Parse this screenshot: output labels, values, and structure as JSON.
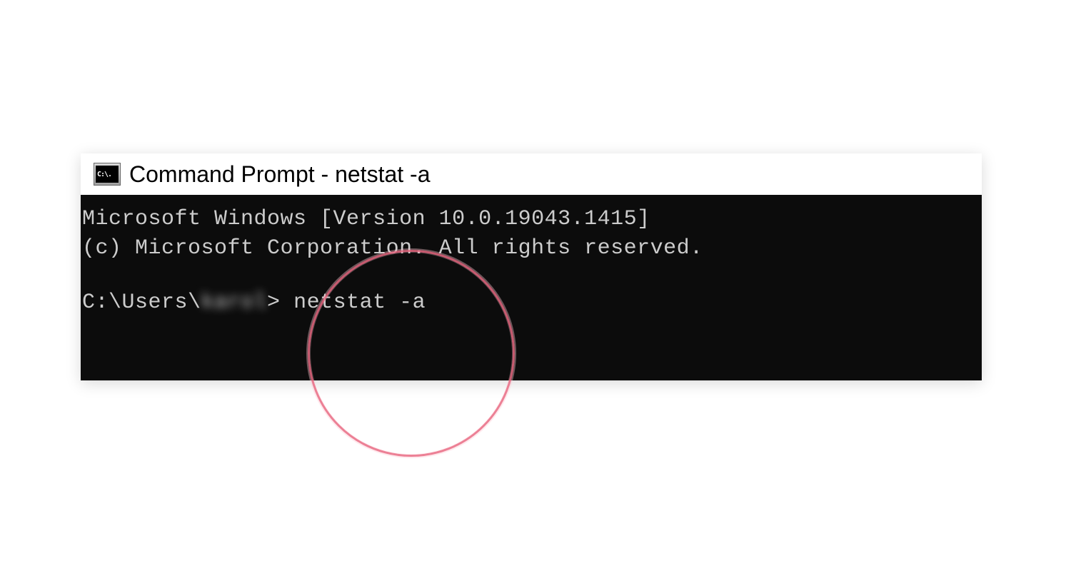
{
  "window": {
    "title": "Command Prompt - netstat  -a",
    "icon_label": "C:\\."
  },
  "terminal": {
    "line1": "Microsoft Windows [Version 10.0.19043.1415]",
    "line2": "(c) Microsoft Corporation. All rights reserved.",
    "prompt_prefix": "C:\\Users\\",
    "prompt_user": "karol",
    "prompt_suffix": "> ",
    "command": "netstat -a"
  }
}
